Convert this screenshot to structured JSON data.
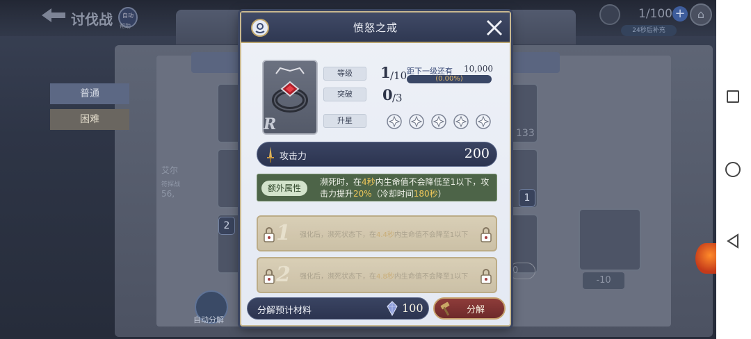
{
  "background": {
    "back_title": "讨伐战",
    "help_badge_label": "自动",
    "help_label": "帮助",
    "stamina": "1/100",
    "refill_timer": "24秒后补充",
    "tab_normal": "普通",
    "tab_hard": "困难",
    "auto_decompose_label": "自动分解",
    "card_counts": [
      "133",
      "1",
      "2"
    ],
    "minus_value": "-10",
    "field_value": "0",
    "faint_texts": [
      "艾尔",
      "符探战",
      "56,"
    ]
  },
  "modal": {
    "title": "愤怒之戒",
    "rarity": "R",
    "stats": {
      "level_label": "等级",
      "level_current": "1",
      "level_max": "/10",
      "breakthrough_label": "突破",
      "breakthrough_current": "0",
      "breakthrough_max": "/3",
      "star_label": "升星",
      "stars_filled": 0,
      "stars_total": 5
    },
    "next_level": {
      "label": "距下一级还有",
      "value": "10,000",
      "percent_text": "(0.00%)",
      "progress": 0.0
    },
    "attack": {
      "label": "攻击力",
      "value": "200"
    },
    "extra": {
      "tag": "额外属性",
      "text_parts": [
        "濒死时，在",
        "4秒",
        "内生命值不会降低至1以下，攻击力提升",
        "20%",
        "（冷却时间",
        "180秒",
        "）"
      ]
    },
    "locked": [
      {
        "num": "1",
        "text_parts": [
          "强化后，濒死状态下，在",
          "4.4秒",
          "内生命值不会降至1以下"
        ]
      },
      {
        "num": "2",
        "text_parts": [
          "强化后，濒死状态下，在",
          "4.8秒",
          "内生命值不会降至1以下"
        ]
      }
    ],
    "materials": {
      "label": "分解预计材料",
      "value": "100"
    },
    "decompose_label": "分解"
  },
  "colors": {
    "modal_header": "#2f3852",
    "accent_gold": "#c9a866",
    "highlight": "#f2c95a",
    "extra_bg": "#4d6448",
    "decompose_btn": "#8e3c3a"
  }
}
